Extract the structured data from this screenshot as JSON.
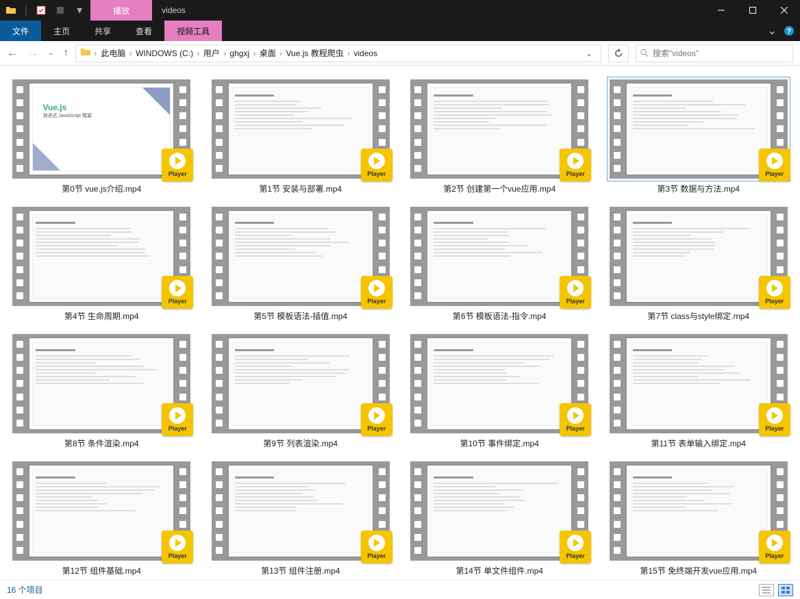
{
  "titlebar": {
    "play_label": "播放",
    "window_title": "videos"
  },
  "ribbon": {
    "file": "文件",
    "home": "主页",
    "share": "共享",
    "view": "查看",
    "video_tools": "视频工具"
  },
  "breadcrumb": {
    "items": [
      "此电脑",
      "WINDOWS (C:)",
      "用户",
      "ghgxj",
      "桌面",
      "Vue.js 教程爬虫",
      "videos"
    ]
  },
  "search": {
    "placeholder": "搜索\"videos\""
  },
  "player_badge": "Player",
  "vue_thumb": {
    "title": "Vue.js",
    "subtitle": "渐进式 JavaScript 框架"
  },
  "files": [
    {
      "name": "第0节 vue.js介绍.mp4",
      "thumb": "vue"
    },
    {
      "name": "第1节 安装与部署.mp4",
      "thumb": "doc"
    },
    {
      "name": "第2节 创建第一个vue应用.mp4",
      "thumb": "doc"
    },
    {
      "name": "第3节 数据与方法.mp4",
      "thumb": "doc",
      "selected": true
    },
    {
      "name": "第4节 生命周期.mp4",
      "thumb": "doc"
    },
    {
      "name": "第5节 模板语法-插值.mp4",
      "thumb": "doc"
    },
    {
      "name": "第6节 模板语法-指令.mp4",
      "thumb": "doc"
    },
    {
      "name": "第7节 class与style绑定.mp4",
      "thumb": "doc"
    },
    {
      "name": "第8节 条件渲染.mp4",
      "thumb": "doc"
    },
    {
      "name": "第9节 列表渲染.mp4",
      "thumb": "doc"
    },
    {
      "name": "第10节 事件绑定.mp4",
      "thumb": "doc"
    },
    {
      "name": "第11节 表单输入绑定.mp4",
      "thumb": "doc"
    },
    {
      "name": "第12节 组件基础.mp4",
      "thumb": "doc"
    },
    {
      "name": "第13节 组件注册.mp4",
      "thumb": "doc"
    },
    {
      "name": "第14节 单文件组件.mp4",
      "thumb": "doc"
    },
    {
      "name": "第15节 免终端开发vue应用.mp4",
      "thumb": "doc"
    }
  ],
  "status": {
    "count_label": "16 个项目"
  }
}
